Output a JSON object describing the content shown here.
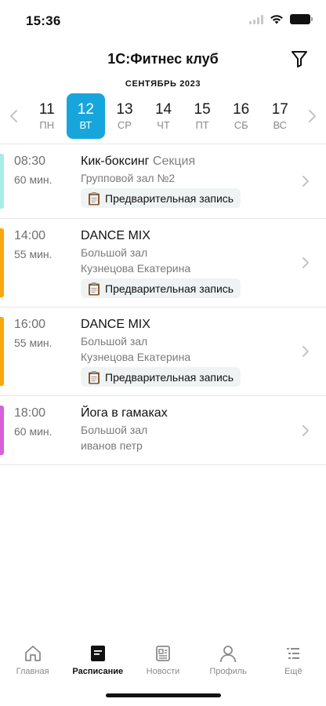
{
  "status_bar": {
    "time": "15:36"
  },
  "header": {
    "title": "1С:Фитнес клуб"
  },
  "calendar": {
    "month": "СЕНТЯБРЬ 2023",
    "days": [
      {
        "num": "11",
        "wd": "ПН",
        "selected": false
      },
      {
        "num": "12",
        "wd": "ВТ",
        "selected": true
      },
      {
        "num": "13",
        "wd": "СР",
        "selected": false
      },
      {
        "num": "14",
        "wd": "ЧТ",
        "selected": false
      },
      {
        "num": "15",
        "wd": "ПТ",
        "selected": false
      },
      {
        "num": "16",
        "wd": "СБ",
        "selected": false
      },
      {
        "num": "17",
        "wd": "ВС",
        "selected": false
      }
    ]
  },
  "sessions": [
    {
      "time": "08:30",
      "duration": "60 мин.",
      "title": "Кик-боксинг",
      "subtitle": "Секция",
      "room": "Групповой зал №2",
      "trainer": "",
      "badge": "Предварительная запись",
      "accent": "#a8ece6"
    },
    {
      "time": "14:00",
      "duration": "55 мин.",
      "title": "DANCE MIX",
      "subtitle": "",
      "room": "Большой зал",
      "trainer": "Кузнецова Екатерина",
      "badge": "Предварительная запись",
      "accent": "#f8a70c"
    },
    {
      "time": "16:00",
      "duration": "55 мин.",
      "title": "DANCE MIX",
      "subtitle": "",
      "room": "Большой зал",
      "trainer": "Кузнецова Екатерина",
      "badge": "Предварительная запись",
      "accent": "#f8a70c"
    },
    {
      "time": "18:00",
      "duration": "60 мин.",
      "title": "Йога в гамаках",
      "subtitle": "",
      "room": "Большой зал",
      "trainer": "иванов петр",
      "badge": "",
      "accent": "#d85fd8"
    }
  ],
  "tabs": [
    {
      "label": "Главная",
      "icon": "home-icon",
      "active": false
    },
    {
      "label": "Расписание",
      "icon": "schedule-icon",
      "active": true
    },
    {
      "label": "Новости",
      "icon": "news-icon",
      "active": false
    },
    {
      "label": "Профиль",
      "icon": "profile-icon",
      "active": false
    },
    {
      "label": "Ещё",
      "icon": "more-icon",
      "active": false
    }
  ],
  "colors": {
    "accent_blue": "#17a6db",
    "divider": "#e6e6e6",
    "badge_bg": "#f0f3f4"
  }
}
